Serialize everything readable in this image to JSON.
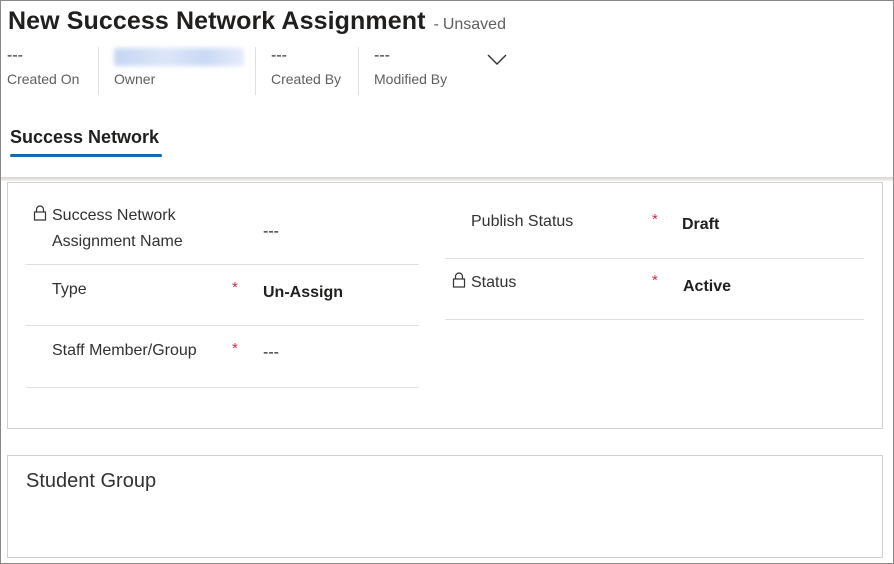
{
  "header": {
    "title": "New Success Network Assignment",
    "separator": "-",
    "save_state": "Unsaved",
    "meta": [
      {
        "value": "---",
        "label": "Created On"
      },
      {
        "value": "",
        "label": "Owner"
      },
      {
        "value": "---",
        "label": "Created By"
      },
      {
        "value": "---",
        "label": "Modified By"
      }
    ]
  },
  "tabs": [
    {
      "label": "Success Network",
      "selected": true
    }
  ],
  "form": {
    "left": [
      {
        "label_line1": "Success Network",
        "label_line2": "Assignment Name",
        "value": "---",
        "locked": true,
        "required": false
      },
      {
        "label": "Type",
        "value": "Un-Assign",
        "required": true,
        "required_mark": "*"
      },
      {
        "label": "Staff Member/Group",
        "value": "---",
        "required": true,
        "required_mark": "*"
      }
    ],
    "right": [
      {
        "label": "Publish Status",
        "value": "Draft",
        "required": true,
        "required_mark": "*"
      },
      {
        "label": "Status",
        "value": "Active",
        "locked": true,
        "required": true,
        "required_mark": "*"
      }
    ]
  },
  "sections": {
    "student_group": "Student Group"
  },
  "colors": {
    "accent": "#0f6cbd",
    "required": "#c4314b",
    "text": "#323130",
    "muted": "#605e5c"
  }
}
